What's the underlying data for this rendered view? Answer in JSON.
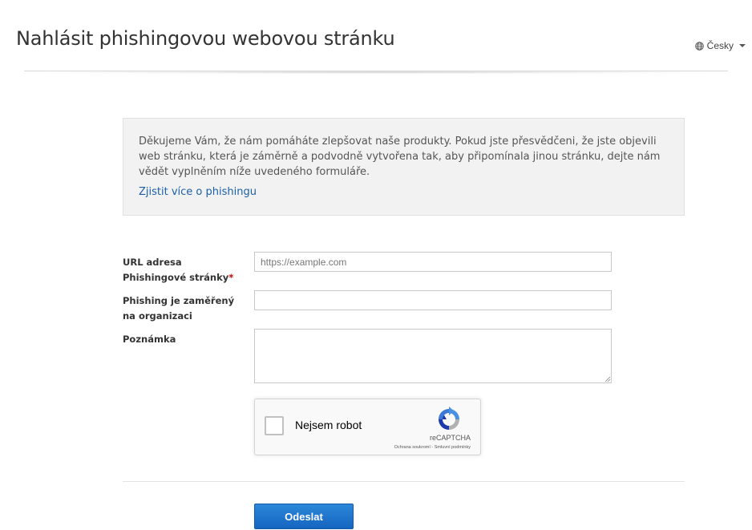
{
  "header": {
    "title": "Nahlásit phishingovou webovou stránku",
    "language": "Česky",
    "language_icon": "globe-icon"
  },
  "info": {
    "text": "Děkujeme Vám, že nám pomáháte zlepšovat naše produkty. Pokud jste přesvědčeni, že jste objevili web stránku, která je záměrně a podvodně vytvořena tak, aby připomínala jinou stránku, dejte nám vědět vyplněním níže uvedeného formuláře.",
    "link": "Zjistit více o phishingu"
  },
  "form": {
    "url_label": "URL adresa Phishingové stránky",
    "required_mark": "*",
    "url_placeholder": "https://example.com",
    "url_value": "",
    "org_label": "Phishing je zaměřený na organizaci",
    "org_value": "",
    "note_label": "Poznámka",
    "note_value": "",
    "submit_label": "Odeslat"
  },
  "recaptcha": {
    "label": "Nejsem robot",
    "brand": "reCAPTCHA",
    "terms": "Ochrana soukromí - Smluvní podmínky",
    "checked": false,
    "colors": {
      "blue": "#4a90e2",
      "dark_blue": "#1c3aa9",
      "gray": "#b1b1b1"
    }
  },
  "colors": {
    "link": "#1a5fa8",
    "required": "#cc0000",
    "button": "#1a73cf",
    "info_bg": "#f2f2f2"
  }
}
